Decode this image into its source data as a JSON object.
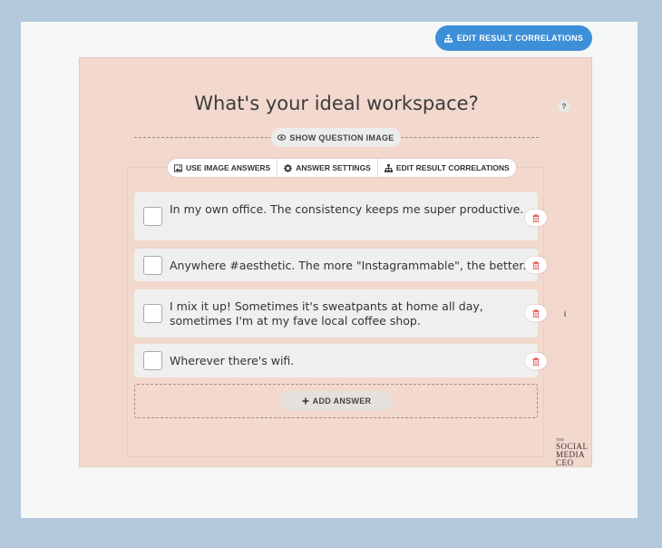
{
  "header": {
    "edit_correlations_label": "EDIT RESULT CORRELATIONS"
  },
  "question": {
    "title": "What's your ideal workspace?",
    "help_glyph": "?",
    "show_image_label": "SHOW QUESTION IMAGE"
  },
  "toolbar": {
    "use_image_answers": "USE IMAGE ANSWERS",
    "answer_settings": "ANSWER SETTINGS",
    "edit_correlations": "EDIT RESULT CORRELATIONS"
  },
  "answers": [
    {
      "text": "In my own office. The consistency keeps me super productive."
    },
    {
      "text": "Anywhere #aesthetic. The more \"Instagrammable\", the better."
    },
    {
      "text": "I mix it up! Sometimes it's sweatpants at home all day, sometimes I'm at my fave local coffee shop."
    },
    {
      "text": "Wherever there's wifi."
    }
  ],
  "info_glyph": "i",
  "add_answer_label": "ADD ANSWER",
  "logo": {
    "line1": "THE",
    "line2": "SOCIAL",
    "line3": "MEDIA",
    "line4": "CEO"
  },
  "colors": {
    "accent": "#3d8fd8",
    "panel": "#f2d8cd",
    "trash": "#e05555"
  },
  "icons": {
    "sitemap": "sitemap-icon",
    "eye": "eye-icon",
    "image": "image-icon",
    "gear": "gear-icon",
    "trash": "trash-icon",
    "plus": "plus-icon",
    "help": "help-icon",
    "info": "info-icon"
  }
}
